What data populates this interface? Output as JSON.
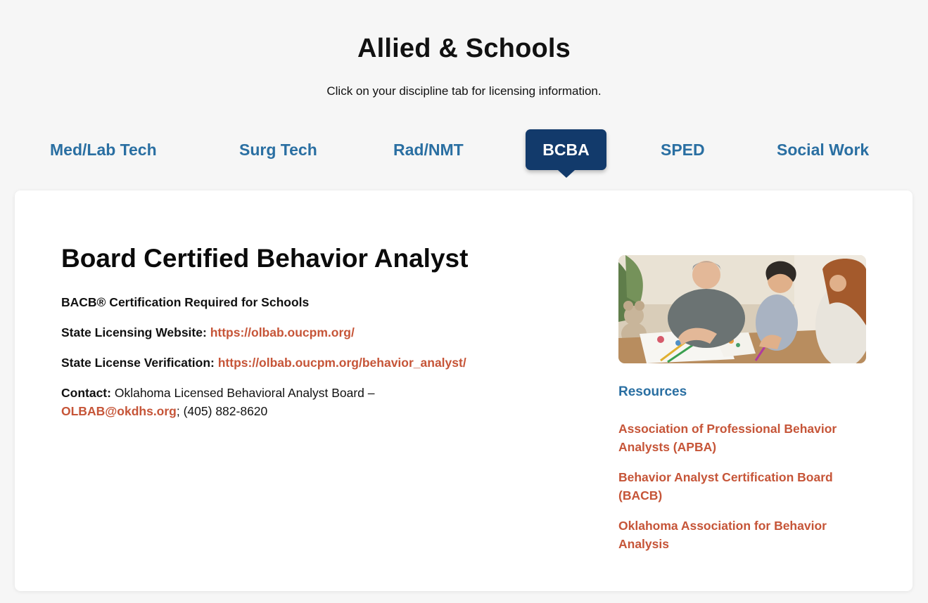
{
  "page": {
    "title": "Allied & Schools",
    "subtitle": "Click on your discipline tab for licensing information."
  },
  "tabs": [
    {
      "label": "Med/Lab Tech",
      "active": false
    },
    {
      "label": "Surg Tech",
      "active": false
    },
    {
      "label": "Rad/NMT",
      "active": false
    },
    {
      "label": "BCBA",
      "active": true
    },
    {
      "label": "SPED",
      "active": false
    },
    {
      "label": "Social Work",
      "active": false
    }
  ],
  "content": {
    "heading": "Board Certified Behavior Analyst",
    "certification": "BACB® Certification Required for Schools",
    "website_label": "State Licensing Website:",
    "website_url": "https://olbab.oucpm.org/",
    "verification_label": "State License Verification:",
    "verification_url": "https://olbab.oucpm.org/behavior_analyst/",
    "contact_label": "Contact:",
    "contact_name": "Oklahoma Licensed Behavioral Analyst Board –",
    "contact_email": "OLBAB@okdhs.org",
    "contact_phone": "; (405) 882-8620"
  },
  "resources": {
    "heading": "Resources",
    "links": [
      {
        "label": "Association of Professional Behavior Analysts (APBA)"
      },
      {
        "label": "Behavior Analyst Certification Board (BACB)"
      },
      {
        "label": "Oklahoma Association for Behavior Analysis"
      }
    ]
  },
  "colors": {
    "background": "#f6f6f6",
    "tab_text": "#2a6fa2",
    "tab_active_bg": "#123a6b",
    "link": "#c65538",
    "resources_heading": "#2a6fa2"
  }
}
